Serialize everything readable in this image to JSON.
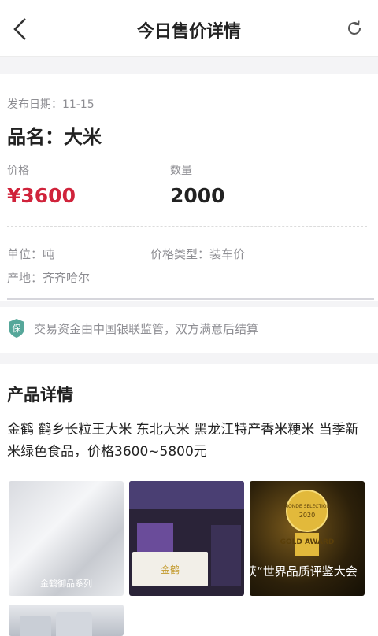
{
  "header": {
    "title": "今日售价详情",
    "back_icon": "chevron-left-icon",
    "refresh_icon": "refresh-icon"
  },
  "listing": {
    "publish_date": "发布日期：11-15",
    "product_name": "品名：大米",
    "price_label": "价格",
    "price_value": "¥3600",
    "quantity_label": "数量",
    "quantity_value": "2000",
    "unit": "单位：吨",
    "price_type": "价格类型：装车价",
    "origin": "产地：齐齐哈尔"
  },
  "notice": {
    "icon": "保",
    "text": "交易资金由中国银联监管，双方满意后结算"
  },
  "product_detail": {
    "title": "产品详情",
    "description": "金鹤 鹤乡长粒王大米 东北大米 黑龙江特产香米粳米 当季新米绿色食品，价格3600~5800元",
    "images": [
      {
        "caption": "金鹤御品系列"
      },
      {
        "caption": "金鹤"
      },
      {
        "caption": "获“世界品质评鉴大会",
        "badge_top": "MONDE SELECTION",
        "badge_year": "2020",
        "badge_award": "GOLD AWARD"
      },
      {
        "caption": ""
      }
    ]
  },
  "colors": {
    "accent_red": "#d0233b",
    "muted_text": "#8e8e93",
    "shield_green": "#56a79a"
  }
}
